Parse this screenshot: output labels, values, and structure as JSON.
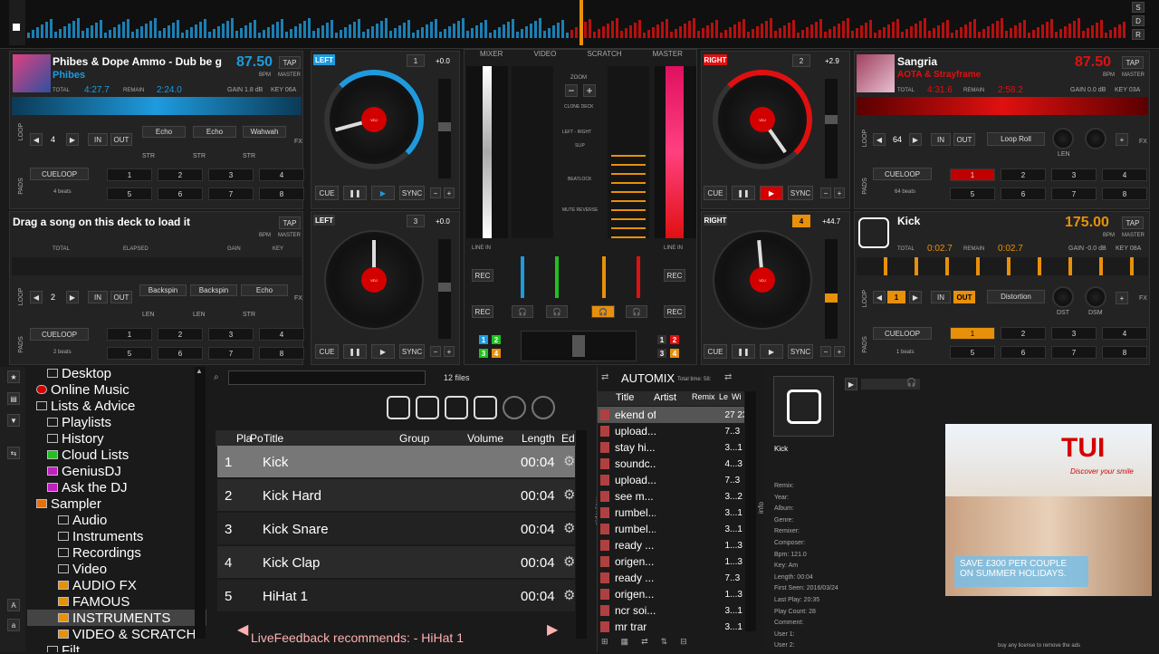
{
  "top": {
    "side_labels": [
      "S",
      "D",
      "R"
    ]
  },
  "decks": [
    {
      "id": 1,
      "title": "Phibes & Dope Ammo - Dub be g",
      "artist": "Phibes",
      "bpm": "87.50",
      "tap": "TAP",
      "bpm_lbl": "BPM",
      "master": "MASTER",
      "total_lbl": "TOTAL",
      "total": "4:27.7",
      "remain_lbl": "REMAIN",
      "remain": "2:24.0",
      "gain": "GAIN 1.8 dB",
      "key": "KEY 06A",
      "side": "LEFT",
      "num": "1",
      "pitch": "+0.0",
      "loop": "4",
      "fx": [
        "Echo",
        "Echo",
        "Wahwah"
      ],
      "fx_sub": [
        "STR",
        "STR",
        "STR"
      ],
      "cueloop": "CUELOOP",
      "beats": "4 beats",
      "pads": [
        "1",
        "2",
        "3",
        "4",
        "5",
        "6",
        "7",
        "8"
      ],
      "cue": "CUE",
      "sync": "SYNC",
      "in": "IN",
      "out": "OUT"
    },
    {
      "id": 2,
      "title": "Sangria",
      "artist": "AOTA & Strayframe",
      "bpm": "87.50",
      "tap": "TAP",
      "bpm_lbl": "BPM",
      "master": "MASTER",
      "total_lbl": "TOTAL",
      "total": "4:31.6",
      "remain_lbl": "REMAIN",
      "remain": "2:58.2",
      "gain": "GAIN 0.0 dB",
      "key": "KEY 03A",
      "side": "RIGHT",
      "num": "2",
      "pitch": "+2.9",
      "loop": "64",
      "fx": [
        "Loop Roll"
      ],
      "fx_sub": [
        "LEN"
      ],
      "cueloop": "CUELOOP",
      "beats": "64 beats",
      "pads": [
        "1",
        "2",
        "3",
        "4",
        "5",
        "6",
        "7",
        "8"
      ],
      "cue": "CUE",
      "sync": "SYNC",
      "in": "IN",
      "out": "OUT"
    },
    {
      "id": 3,
      "title": "Drag a song on this deck to load it",
      "tap": "TAP",
      "bpm_lbl": "BPM",
      "master": "MASTER",
      "total_lbl": "TOTAL",
      "elapsed_lbl": "ELAPSED",
      "gain_lbl": "GAIN",
      "key_lbl": "KEY",
      "side": "LEFT",
      "num": "3",
      "pitch": "+0.0",
      "loop": "2",
      "fx": [
        "Backspin",
        "Backspin",
        "Echo"
      ],
      "fx_sub": [
        "LEN",
        "LEN",
        "STR"
      ],
      "cueloop": "CUELOOP",
      "beats": "2 beats",
      "pads": [
        "1",
        "2",
        "3",
        "4",
        "5",
        "6",
        "7",
        "8"
      ],
      "cue": "CUE",
      "sync": "SYNC",
      "in": "IN",
      "out": "OUT"
    },
    {
      "id": 4,
      "title": "Kick",
      "bpm": "175.00",
      "tap": "TAP",
      "bpm_lbl": "BPM",
      "master": "MASTER",
      "total_lbl": "TOTAL",
      "total": "0:02.7",
      "remain_lbl": "REMAIN",
      "remain": "0:02.7",
      "gain": "GAIN -0.0 dB",
      "key": "KEY 08A",
      "side": "RIGHT",
      "num": "4",
      "pitch": "+44.7",
      "loop": "1",
      "fx": [
        "Distortion"
      ],
      "fx_sub": [
        "DST",
        "DSM"
      ],
      "cueloop": "CUELOOP",
      "beats": "1 beats",
      "pads": [
        "1",
        "2",
        "3",
        "4",
        "5",
        "6",
        "7",
        "8"
      ],
      "cue": "CUE",
      "sync": "SYNC",
      "in": "IN",
      "out": "OUT"
    }
  ],
  "side_labels": {
    "loop": "LOOP",
    "pads": "PADS",
    "fx": "FX"
  },
  "mixer": {
    "tabs": [
      "MIXER",
      "VIDEO",
      "SCRATCH",
      "MASTER"
    ],
    "zoom": "ZOOM",
    "clone": "CLONE DECK",
    "leftright": "LEFT - RIGHT",
    "slip": "SLIP",
    "beatlock": "BEATLOCK",
    "mute": "MUTE REVERSE",
    "line_in": "LINE IN",
    "rec": "REC",
    "deck_nums": [
      "1",
      "2",
      "3",
      "4"
    ]
  },
  "browser": {
    "tree": [
      "Desktop",
      "Online Music",
      "Lists & Advice",
      "Playlists",
      "History",
      "Cloud Lists",
      "GeniusDJ",
      "Ask the DJ",
      "Sampler",
      "Audio",
      "Instruments",
      "Recordings",
      "Video",
      "AUDIO FX",
      "FAMOUS",
      "INSTRUMENTS",
      "VIDEO & SCRATCH",
      "Filt"
    ],
    "file_count": "12 files",
    "headers": [
      "Pla",
      "Po",
      "Title",
      "Group",
      "Volume",
      "Length",
      "Ed"
    ],
    "folders_tab": "folders",
    "sideview_tab": "sideview",
    "rows": [
      {
        "n": "1",
        "title": "Kick",
        "len": "00:04"
      },
      {
        "n": "2",
        "title": "Kick Hard",
        "len": "00:04"
      },
      {
        "n": "3",
        "title": "Kick Snare",
        "len": "00:04"
      },
      {
        "n": "4",
        "title": "Kick Clap",
        "len": "00:04"
      },
      {
        "n": "5",
        "title": "HiHat 1",
        "len": "00:04"
      }
    ],
    "livefeedback": "LiveFeedback recommends:  - HiHat 1"
  },
  "automix": {
    "title": "AUTOMIX",
    "total": "Total time: 58:",
    "headers": [
      "Title",
      "Artist",
      "Remix",
      "Le",
      "Wi"
    ],
    "rows": [
      {
        "t": "ekend offi",
        "n": "27 23"
      },
      {
        "t": "upload...",
        "n": "7..3"
      },
      {
        "t": "stay hi...",
        "n": "3...1"
      },
      {
        "t": "soundc...",
        "n": "4...3"
      },
      {
        "t": "upload...",
        "n": "7..3"
      },
      {
        "t": "see m...",
        "n": "3...2"
      },
      {
        "t": "rumbel...",
        "n": "3...1"
      },
      {
        "t": "rumbel...",
        "n": "3...1"
      },
      {
        "t": "ready ...",
        "n": "1...3"
      },
      {
        "t": "origen...",
        "n": "1...3"
      },
      {
        "t": "ready ...",
        "n": "7..3"
      },
      {
        "t": "origen...",
        "n": "1...3"
      },
      {
        "t": "ncr soi...",
        "n": "3...1"
      },
      {
        "t": "mr trar",
        "n": "3...1"
      }
    ]
  },
  "info": {
    "tab": "info",
    "name": "Kick",
    "fields": [
      "Remix:",
      "Year:",
      "Album:",
      "Genre:",
      "Remixer:",
      "Composer:",
      "Bpm: 121.0",
      "Key: Am",
      "Length: 00:04",
      "First Seen: 2016/03/24",
      "Last Play: 20:35",
      "Play Count: 28",
      "Comment:",
      "User 1:",
      "User 2:"
    ],
    "ad_brand": "TUI",
    "ad_slogan": "Discover your smile",
    "ad_text1": "SAVE £300 PER COUPLE",
    "ad_text2": "ON SUMMER HOLIDAYS.",
    "ad_footer": "buy any license to remove the ads"
  },
  "colors": {
    "left": "#1e9bde",
    "right": "#e01010",
    "orange": "#e8900a",
    "red": "#d40000"
  }
}
